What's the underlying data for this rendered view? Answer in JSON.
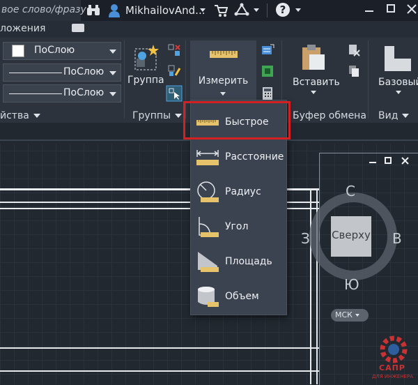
{
  "titlebar": {
    "search_placeholder": "вое слово/фразу",
    "username": "MikhailovAnd...",
    "help_label": "?"
  },
  "tabrow": {
    "partial_tab": "ложения"
  },
  "ribbon": {
    "properties": {
      "color_value": "ПоСлою",
      "linetype_value": "ПоСлою",
      "lineweight_value": "ПоСлою",
      "title": "йства"
    },
    "groups": {
      "group_label": "Группа",
      "title": "Группы"
    },
    "measure": {
      "label": "Измерить"
    },
    "clipboard": {
      "paste_label": "Вставить",
      "title": "Буфер обмена"
    },
    "view": {
      "base_label": "Базовый",
      "title": "Вид"
    }
  },
  "measure_menu": {
    "items": [
      {
        "label": "Быстрое",
        "icon": "ruler-quick-icon"
      },
      {
        "label": "Расстояние",
        "icon": "distance-icon"
      },
      {
        "label": "Радиус",
        "icon": "radius-icon"
      },
      {
        "label": "Угол",
        "icon": "angle-icon"
      },
      {
        "label": "Площадь",
        "icon": "area-icon"
      },
      {
        "label": "Объем",
        "icon": "volume-icon"
      }
    ]
  },
  "viewcube": {
    "north": "С",
    "south": "Ю",
    "east": "В",
    "west": "З",
    "face": "Сверху",
    "ucs_label": "МСК"
  },
  "watermark": {
    "line1": "САПР",
    "line2": "ДЛЯ ИНЖЕНЕРА"
  }
}
